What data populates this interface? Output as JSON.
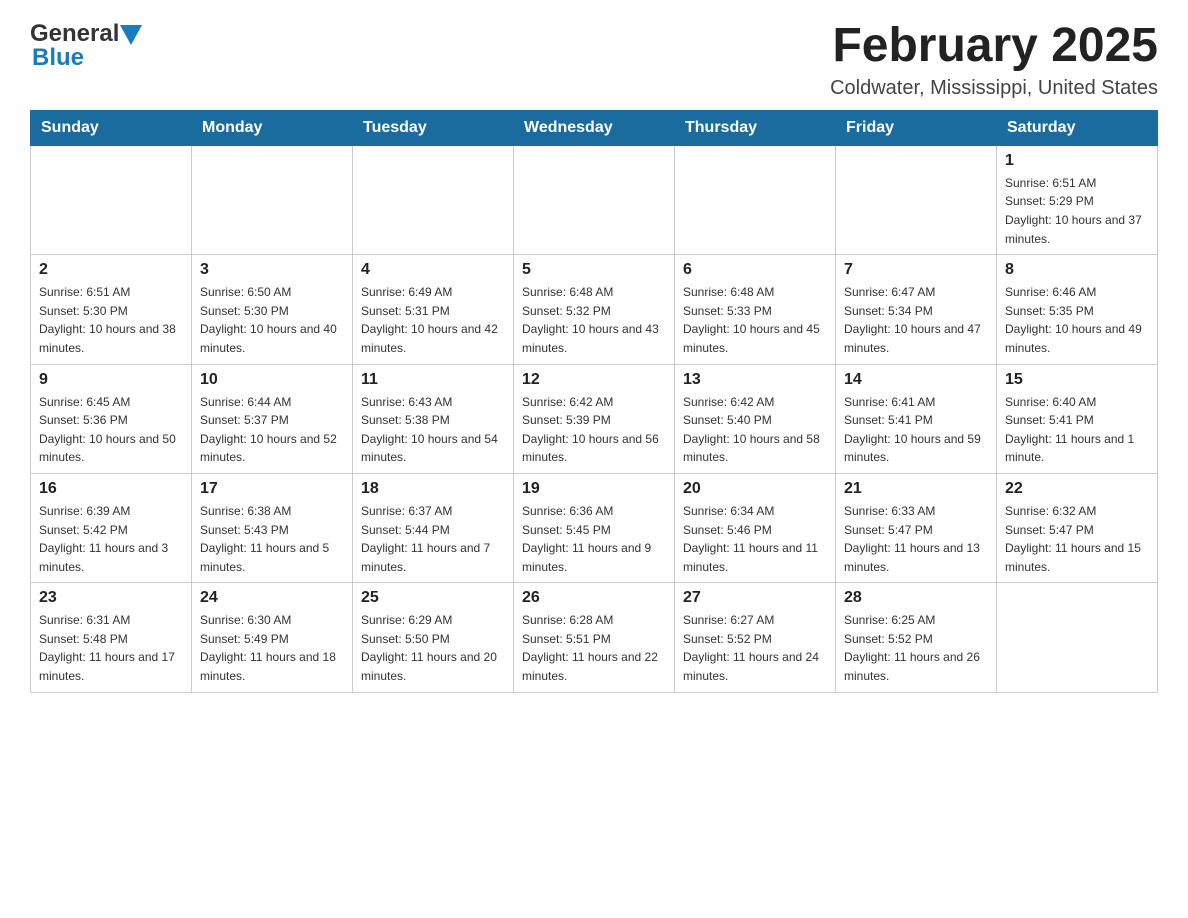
{
  "header": {
    "logo_general": "General",
    "logo_blue": "Blue",
    "title": "February 2025",
    "subtitle": "Coldwater, Mississippi, United States"
  },
  "days_of_week": [
    "Sunday",
    "Monday",
    "Tuesday",
    "Wednesday",
    "Thursday",
    "Friday",
    "Saturday"
  ],
  "weeks": [
    {
      "days": [
        {
          "num": "",
          "info": ""
        },
        {
          "num": "",
          "info": ""
        },
        {
          "num": "",
          "info": ""
        },
        {
          "num": "",
          "info": ""
        },
        {
          "num": "",
          "info": ""
        },
        {
          "num": "",
          "info": ""
        },
        {
          "num": "1",
          "info": "Sunrise: 6:51 AM\nSunset: 5:29 PM\nDaylight: 10 hours and 37 minutes."
        }
      ]
    },
    {
      "days": [
        {
          "num": "2",
          "info": "Sunrise: 6:51 AM\nSunset: 5:30 PM\nDaylight: 10 hours and 38 minutes."
        },
        {
          "num": "3",
          "info": "Sunrise: 6:50 AM\nSunset: 5:30 PM\nDaylight: 10 hours and 40 minutes."
        },
        {
          "num": "4",
          "info": "Sunrise: 6:49 AM\nSunset: 5:31 PM\nDaylight: 10 hours and 42 minutes."
        },
        {
          "num": "5",
          "info": "Sunrise: 6:48 AM\nSunset: 5:32 PM\nDaylight: 10 hours and 43 minutes."
        },
        {
          "num": "6",
          "info": "Sunrise: 6:48 AM\nSunset: 5:33 PM\nDaylight: 10 hours and 45 minutes."
        },
        {
          "num": "7",
          "info": "Sunrise: 6:47 AM\nSunset: 5:34 PM\nDaylight: 10 hours and 47 minutes."
        },
        {
          "num": "8",
          "info": "Sunrise: 6:46 AM\nSunset: 5:35 PM\nDaylight: 10 hours and 49 minutes."
        }
      ]
    },
    {
      "days": [
        {
          "num": "9",
          "info": "Sunrise: 6:45 AM\nSunset: 5:36 PM\nDaylight: 10 hours and 50 minutes."
        },
        {
          "num": "10",
          "info": "Sunrise: 6:44 AM\nSunset: 5:37 PM\nDaylight: 10 hours and 52 minutes."
        },
        {
          "num": "11",
          "info": "Sunrise: 6:43 AM\nSunset: 5:38 PM\nDaylight: 10 hours and 54 minutes."
        },
        {
          "num": "12",
          "info": "Sunrise: 6:42 AM\nSunset: 5:39 PM\nDaylight: 10 hours and 56 minutes."
        },
        {
          "num": "13",
          "info": "Sunrise: 6:42 AM\nSunset: 5:40 PM\nDaylight: 10 hours and 58 minutes."
        },
        {
          "num": "14",
          "info": "Sunrise: 6:41 AM\nSunset: 5:41 PM\nDaylight: 10 hours and 59 minutes."
        },
        {
          "num": "15",
          "info": "Sunrise: 6:40 AM\nSunset: 5:41 PM\nDaylight: 11 hours and 1 minute."
        }
      ]
    },
    {
      "days": [
        {
          "num": "16",
          "info": "Sunrise: 6:39 AM\nSunset: 5:42 PM\nDaylight: 11 hours and 3 minutes."
        },
        {
          "num": "17",
          "info": "Sunrise: 6:38 AM\nSunset: 5:43 PM\nDaylight: 11 hours and 5 minutes."
        },
        {
          "num": "18",
          "info": "Sunrise: 6:37 AM\nSunset: 5:44 PM\nDaylight: 11 hours and 7 minutes."
        },
        {
          "num": "19",
          "info": "Sunrise: 6:36 AM\nSunset: 5:45 PM\nDaylight: 11 hours and 9 minutes."
        },
        {
          "num": "20",
          "info": "Sunrise: 6:34 AM\nSunset: 5:46 PM\nDaylight: 11 hours and 11 minutes."
        },
        {
          "num": "21",
          "info": "Sunrise: 6:33 AM\nSunset: 5:47 PM\nDaylight: 11 hours and 13 minutes."
        },
        {
          "num": "22",
          "info": "Sunrise: 6:32 AM\nSunset: 5:47 PM\nDaylight: 11 hours and 15 minutes."
        }
      ]
    },
    {
      "days": [
        {
          "num": "23",
          "info": "Sunrise: 6:31 AM\nSunset: 5:48 PM\nDaylight: 11 hours and 17 minutes."
        },
        {
          "num": "24",
          "info": "Sunrise: 6:30 AM\nSunset: 5:49 PM\nDaylight: 11 hours and 18 minutes."
        },
        {
          "num": "25",
          "info": "Sunrise: 6:29 AM\nSunset: 5:50 PM\nDaylight: 11 hours and 20 minutes."
        },
        {
          "num": "26",
          "info": "Sunrise: 6:28 AM\nSunset: 5:51 PM\nDaylight: 11 hours and 22 minutes."
        },
        {
          "num": "27",
          "info": "Sunrise: 6:27 AM\nSunset: 5:52 PM\nDaylight: 11 hours and 24 minutes."
        },
        {
          "num": "28",
          "info": "Sunrise: 6:25 AM\nSunset: 5:52 PM\nDaylight: 11 hours and 26 minutes."
        },
        {
          "num": "",
          "info": ""
        }
      ]
    }
  ]
}
